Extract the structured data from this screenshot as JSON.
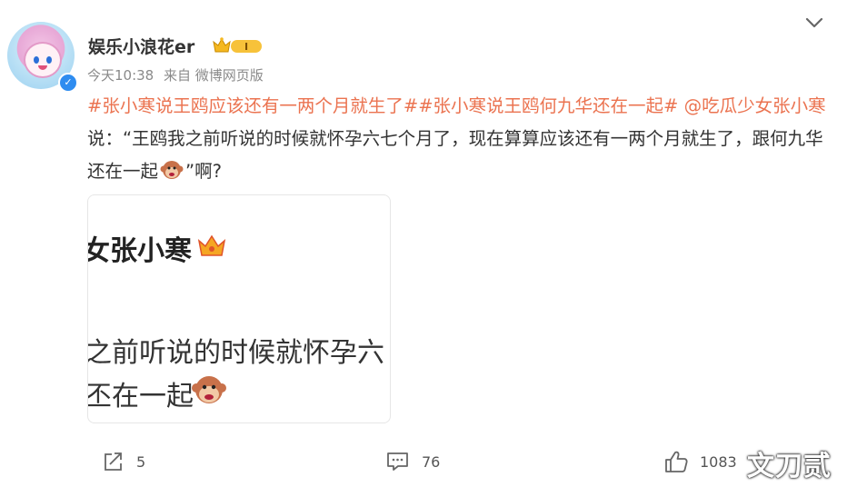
{
  "post": {
    "username": "娱乐小浪花er",
    "user_level": "I",
    "timestamp": "今天10:38",
    "source": "来自 微博网页版",
    "hashtag1": "#张小寒说王鸥应该还有一两个月就生了#",
    "hashtag2": "#张小寒说王鸥何九华还在一起#",
    "mention": "@吃瓜少女张小寒",
    "text_part1": " 说：“王鸥我之前听说的时候就怀孕六七个月了，现在算算应该还有一两个月就生了，跟何九华还在一起",
    "text_part2": "”啊?"
  },
  "image_preview": {
    "line1": "女张小寒",
    "line2": "之前听说的时候就怀孕六",
    "line3": "丕在一起"
  },
  "actions": {
    "repost_count": "5",
    "comment_count": "76",
    "like_count": "1083"
  },
  "watermark": "文刀贰",
  "colors": {
    "link": "#eb7350",
    "text": "#333333",
    "meta": "#8a8a8a",
    "verified": "#2e8cf0"
  }
}
